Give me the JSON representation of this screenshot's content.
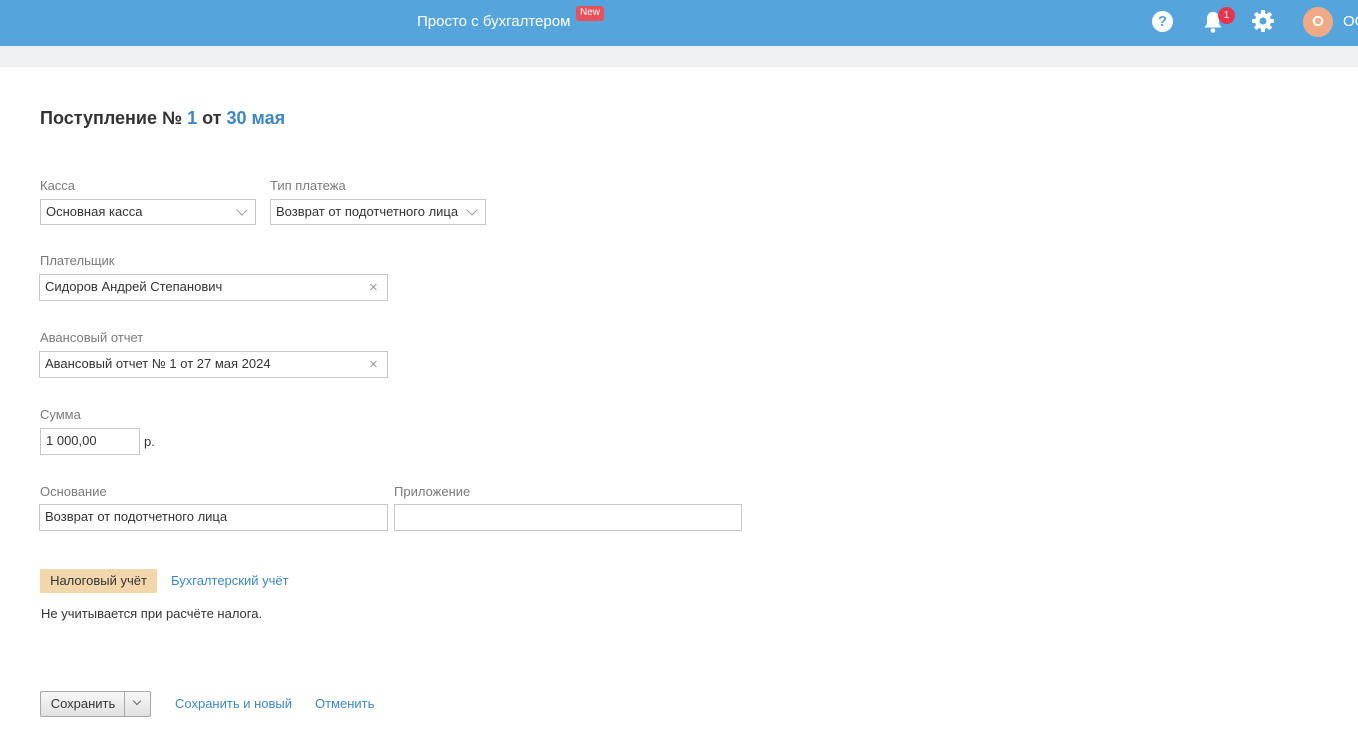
{
  "header": {
    "brand": "Просто с бухгалтером",
    "new_badge": "New",
    "notification_count": "1",
    "avatar_letter": "О",
    "user_name": "ОО"
  },
  "document": {
    "title_prefix": "Поступление №",
    "number": "1",
    "date_prefix": "от",
    "date": "30 мая"
  },
  "form": {
    "cashbox": {
      "label": "Касса",
      "value": "Основная касса"
    },
    "payment_type": {
      "label": "Тип платежа",
      "value": "Возврат от подотчетного лица"
    },
    "payer": {
      "label": "Плательщик",
      "value": "Сидоров Андрей Степанович"
    },
    "advance_report": {
      "label": "Авансовый отчет",
      "value": "Авансовый отчет № 1 от 27 мая 2024"
    },
    "amount": {
      "label": "Сумма",
      "value": "1 000,00",
      "currency": "р."
    },
    "basis": {
      "label": "Основание",
      "value": "Возврат от подотчетного лица"
    },
    "attachment": {
      "label": "Приложение",
      "value": ""
    }
  },
  "tabs": {
    "tax": "Налоговый учёт",
    "accounting": "Бухгалтерский учёт"
  },
  "tax_note": "Не учитывается при расчёте налога.",
  "actions": {
    "save": "Сохранить",
    "save_and_new": "Сохранить и новый",
    "cancel": "Отменить"
  },
  "colors": {
    "header_bg": "#55a5dc",
    "link": "#3f86c0",
    "active_tab": "#f2d7ac",
    "badge": "#e9505a",
    "avatar": "#f0ab86"
  }
}
